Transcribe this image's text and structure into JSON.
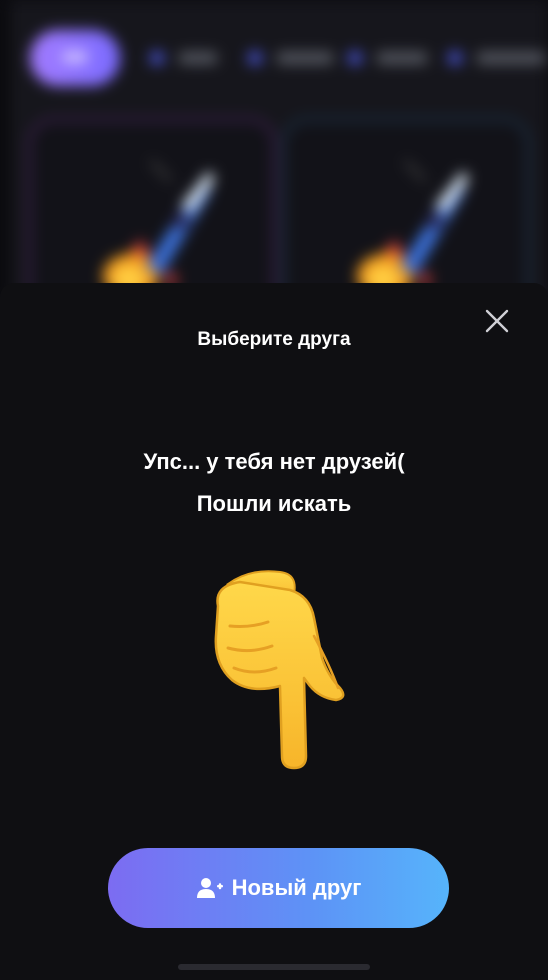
{
  "modal": {
    "title": "Выберите друга",
    "empty_line1": "Упс... у тебя нет друзей(",
    "empty_line2": "Пошли искать",
    "button_label": "Новый друг",
    "button_icon": "add-user-icon",
    "close_icon": "close-icon",
    "illustration": "pointing-down-hand-emoji"
  },
  "colors": {
    "sheet_bg": "#0f0f12",
    "button_gradient_start": "#7c6cf2",
    "button_gradient_end": "#56b4fb"
  }
}
